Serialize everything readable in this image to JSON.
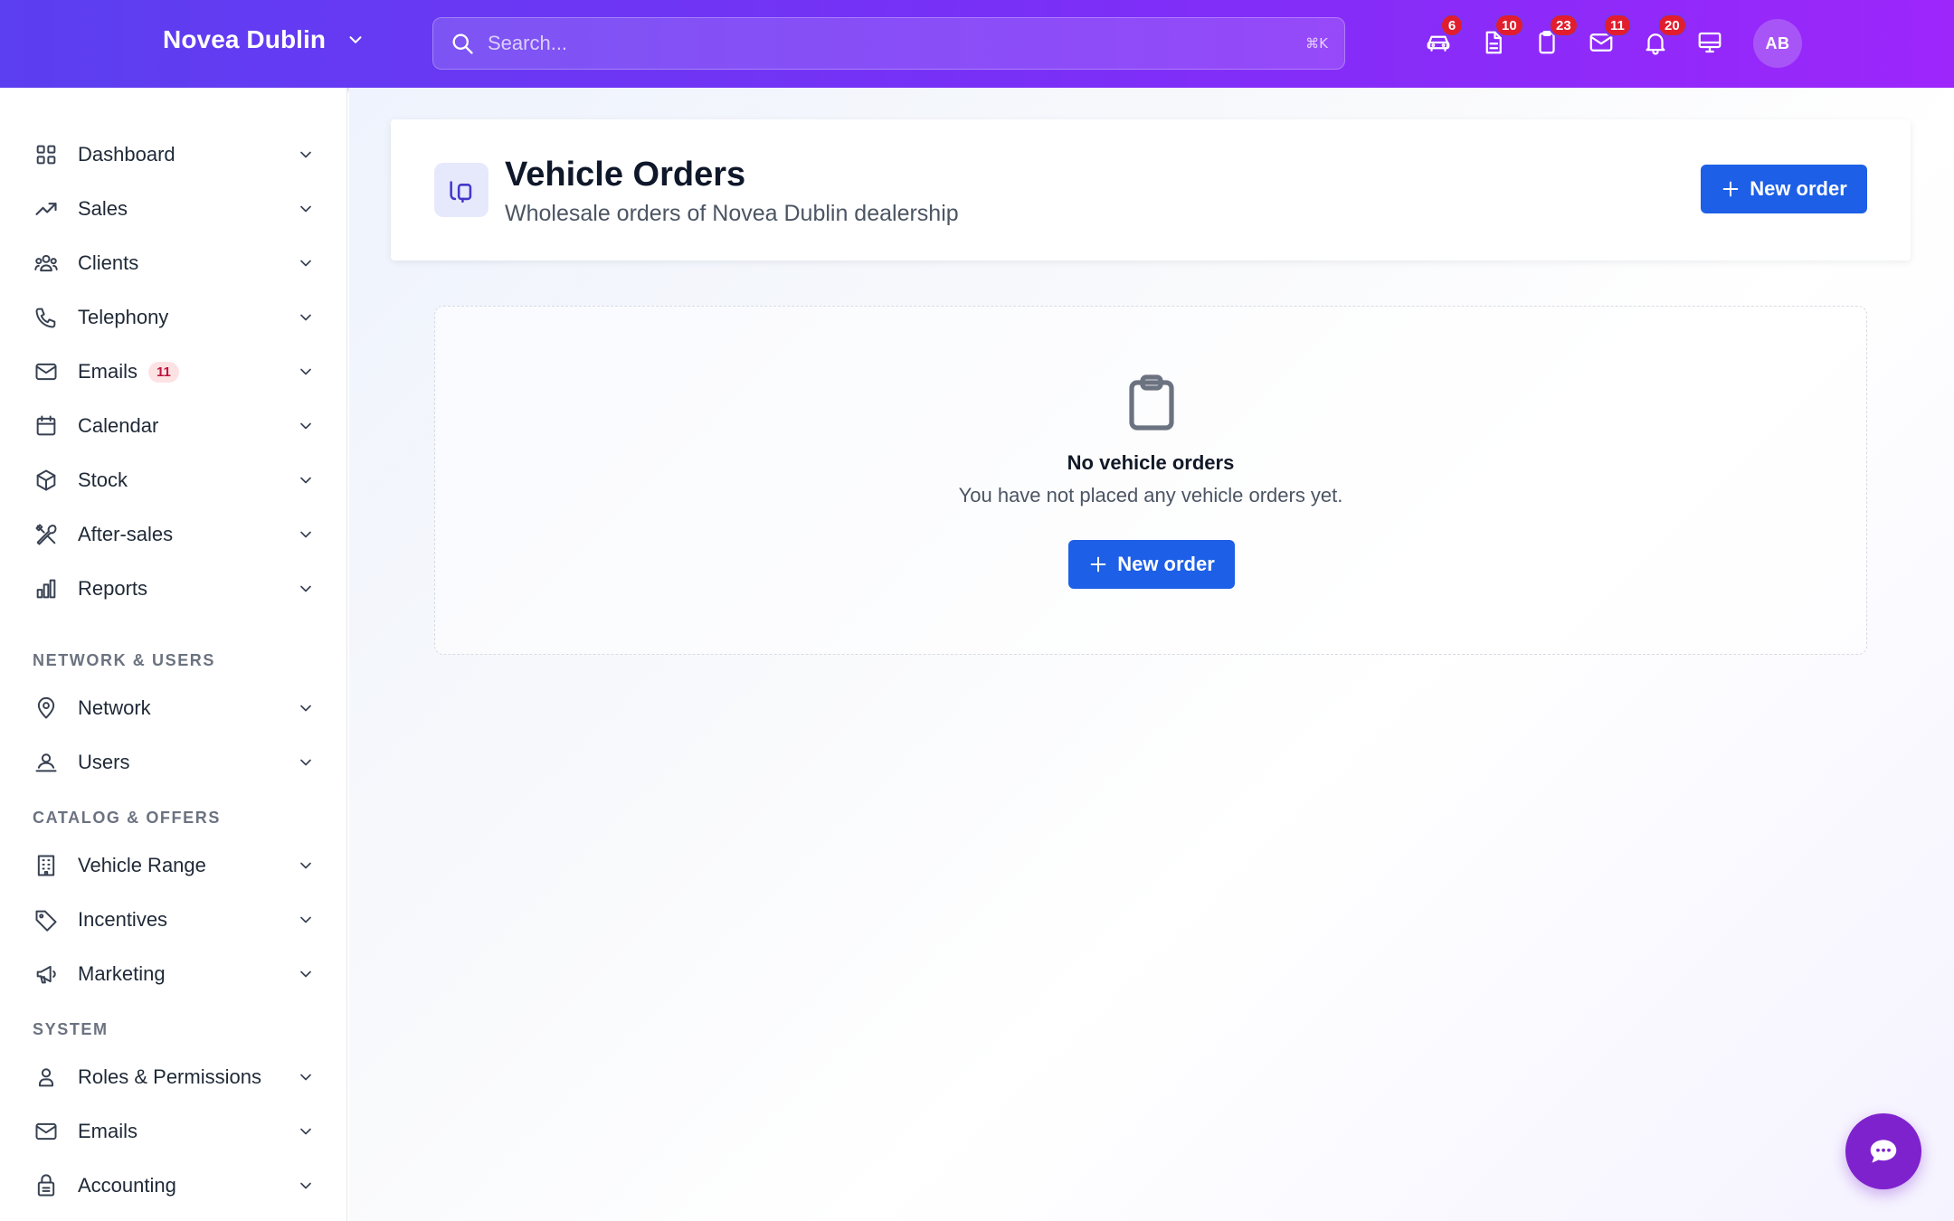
{
  "header": {
    "brand": "Novea Dublin",
    "search_placeholder": "Search...",
    "shortcut": "⌘K",
    "icons": [
      {
        "name": "car-icon",
        "badge": "6"
      },
      {
        "name": "document-icon",
        "badge": "10"
      },
      {
        "name": "clipboard-icon",
        "badge": "23"
      },
      {
        "name": "mail-icon",
        "badge": "11"
      },
      {
        "name": "bell-icon",
        "badge": "20"
      },
      {
        "name": "monitor-icon",
        "badge": ""
      }
    ],
    "avatar_initials": "AB",
    "colors": {
      "gradient_start": "#5b3ff0",
      "gradient_end": "#9d26fb",
      "badge": "#e11d2e"
    }
  },
  "sidebar": {
    "items": [
      {
        "label": "Dashboard",
        "icon": "grid-icon"
      },
      {
        "label": "Sales",
        "icon": "trending-up-icon"
      },
      {
        "label": "Clients",
        "icon": "users-group-icon"
      },
      {
        "label": "Telephony",
        "icon": "phone-icon"
      },
      {
        "label": "Emails",
        "icon": "mail-icon",
        "badge": "11"
      },
      {
        "label": "Calendar",
        "icon": "calendar-icon"
      },
      {
        "label": "Stock",
        "icon": "box-icon"
      },
      {
        "label": "After-sales",
        "icon": "tools-icon"
      },
      {
        "label": "Reports",
        "icon": "bar-chart-icon"
      }
    ],
    "sections": [
      {
        "title": "NETWORK & USERS",
        "items": [
          {
            "label": "Network",
            "icon": "map-pin-icon"
          },
          {
            "label": "Users",
            "icon": "user-network-icon"
          }
        ]
      },
      {
        "title": "CATALOG & OFFERS",
        "items": [
          {
            "label": "Vehicle Range",
            "icon": "building-icon"
          },
          {
            "label": "Incentives",
            "icon": "tag-icon"
          },
          {
            "label": "Marketing",
            "icon": "megaphone-icon"
          }
        ]
      },
      {
        "title": "SYSTEM",
        "items": [
          {
            "label": "Roles & Permissions",
            "icon": "user-icon"
          },
          {
            "label": "Emails",
            "icon": "mail-icon"
          },
          {
            "label": "Accounting",
            "icon": "lock-bag-icon"
          }
        ]
      }
    ]
  },
  "page": {
    "title": "Vehicle Orders",
    "subtitle": "Wholesale orders of Novea Dublin dealership",
    "new_order_label": "New order",
    "accent": "#1d5fe6"
  },
  "empty_state": {
    "title": "No vehicle orders",
    "text": "You have not placed any vehicle orders yet.",
    "button_label": "New order"
  },
  "chat": {
    "icon": "chat-icon",
    "color": "#7e22ce"
  }
}
